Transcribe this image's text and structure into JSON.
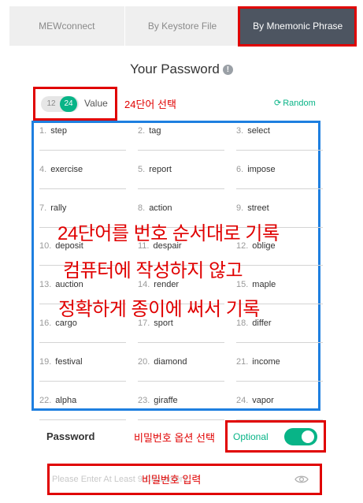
{
  "tabs": [
    {
      "label": "MEWconnect"
    },
    {
      "label": "By Keystore File"
    },
    {
      "label": "By Mnemonic Phrase"
    }
  ],
  "title": "Your Password",
  "length_toggle": {
    "option_12": "12",
    "option_24": "24",
    "label": "Value",
    "annotation": "24단어 선택"
  },
  "random_label": "Random",
  "words": [
    {
      "num": "1.",
      "word": "step"
    },
    {
      "num": "2.",
      "word": "tag"
    },
    {
      "num": "3.",
      "word": "select"
    },
    {
      "num": "4.",
      "word": "exercise"
    },
    {
      "num": "5.",
      "word": "report"
    },
    {
      "num": "6.",
      "word": "impose"
    },
    {
      "num": "7.",
      "word": "rally"
    },
    {
      "num": "8.",
      "word": "action"
    },
    {
      "num": "9.",
      "word": "street"
    },
    {
      "num": "10.",
      "word": "deposit"
    },
    {
      "num": "11.",
      "word": "despair"
    },
    {
      "num": "12.",
      "word": "oblige"
    },
    {
      "num": "13.",
      "word": "auction"
    },
    {
      "num": "14.",
      "word": "render"
    },
    {
      "num": "15.",
      "word": "maple"
    },
    {
      "num": "16.",
      "word": "cargo"
    },
    {
      "num": "17.",
      "word": "sport"
    },
    {
      "num": "18.",
      "word": "differ"
    },
    {
      "num": "19.",
      "word": "festival"
    },
    {
      "num": "20.",
      "word": "diamond"
    },
    {
      "num": "21.",
      "word": "income"
    },
    {
      "num": "22.",
      "word": "alpha"
    },
    {
      "num": "23.",
      "word": "giraffe"
    },
    {
      "num": "24.",
      "word": "vapor"
    }
  ],
  "overlay_notes": [
    "24단어를 번호 순서대로 기록",
    "컴퓨터에 작성하지 않고",
    "정확하게 종이에 써서 기록"
  ],
  "password_section": {
    "label": "Password",
    "annotation": "비밀번호 옵션 선택",
    "optional_label": "Optional",
    "optional_enabled": true,
    "input_placeholder": "Please Enter At Least 9 Characters",
    "input_annotation": "비밀번호 입력"
  },
  "colors": {
    "accent": "#08b487",
    "active_tab": "#4d5561",
    "annotation_red": "#e00000",
    "grid_box_blue": "#1e7fe0"
  }
}
